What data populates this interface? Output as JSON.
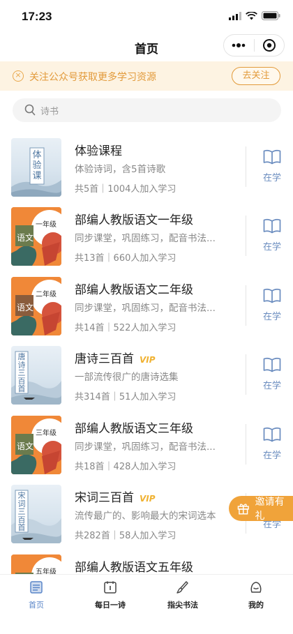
{
  "status": {
    "time": "17:23"
  },
  "nav": {
    "title": "首页"
  },
  "notice": {
    "text": "关注公众号获取更多学习资源",
    "button": "去关注"
  },
  "search": {
    "placeholder": "诗书"
  },
  "courses": [
    {
      "title": "体验课程",
      "vip": "",
      "desc": "体验诗词，含5首诗歌",
      "meta": "共5首｜1004人加入学习",
      "status": "在学",
      "cover_text": "体验课"
    },
    {
      "title": "部编人教版语文一年级",
      "vip": "",
      "desc": "同步课堂，巩固练习，配音书法...",
      "meta": "共13首｜660人加入学习",
      "status": "在学",
      "cover_grade": "一年级",
      "cover_subject": "语文"
    },
    {
      "title": "部编人教版语文二年级",
      "vip": "",
      "desc": "同步课堂，巩固练习，配音书法...",
      "meta": "共14首｜522人加入学习",
      "status": "在学",
      "cover_grade": "二年级",
      "cover_subject": "语文"
    },
    {
      "title": "唐诗三百首",
      "vip": "VIP",
      "desc": "一部流传很广的唐诗选集",
      "meta": "共314首｜51人加入学习",
      "status": "在学",
      "cover_text": "唐诗三百首"
    },
    {
      "title": "部编人教版语文三年级",
      "vip": "",
      "desc": "同步课堂，巩固练习，配音书法...",
      "meta": "共18首｜428人加入学习",
      "status": "在学",
      "cover_grade": "三年级",
      "cover_subject": "语文"
    },
    {
      "title": "宋词三百首",
      "vip": "VIP",
      "desc": "流传最广的、影响最大的宋词选本",
      "meta": "共282首｜58人加入学习",
      "status": "在学",
      "cover_text": "宋词三百首"
    },
    {
      "title": "部编人教版语文五年级",
      "vip": "",
      "desc": "",
      "meta": "",
      "status": "",
      "cover_grade": "五年级",
      "cover_subject": "语文"
    }
  ],
  "float_button": {
    "label": "邀请有礼"
  },
  "tabs": [
    {
      "label": "首页",
      "icon": "home-icon",
      "active": true
    },
    {
      "label": "每日一诗",
      "icon": "calendar-icon",
      "active": false
    },
    {
      "label": "指尖书法",
      "icon": "brush-icon",
      "active": false
    },
    {
      "label": "我的",
      "icon": "profile-icon",
      "active": false
    }
  ],
  "colors": {
    "accent": "#5a86c8",
    "notice": "#e29a3a",
    "vip": "#f0b232",
    "float": "#f0a33a"
  }
}
